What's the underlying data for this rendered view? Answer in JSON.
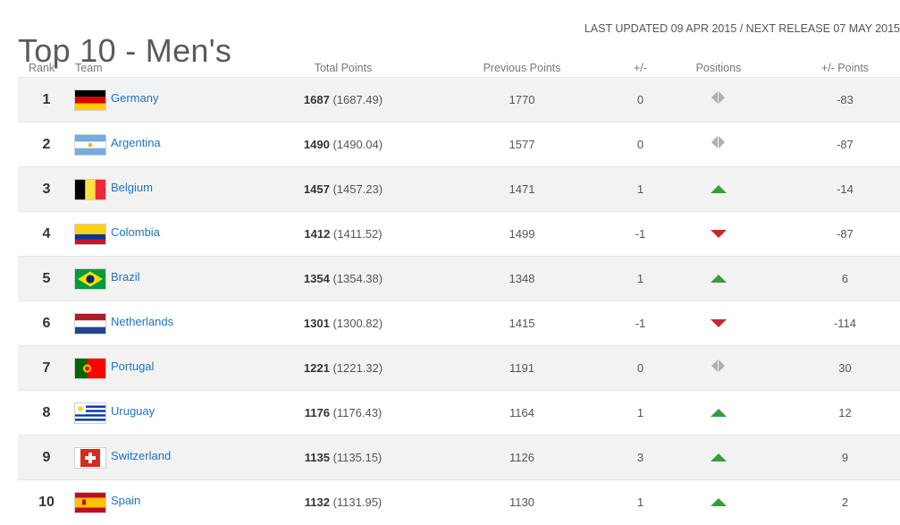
{
  "header": {
    "title": "Top 10 - Men's",
    "updated": "LAST UPDATED 09 APR 2015 / NEXT RELEASE 07 MAY 2015"
  },
  "columns": {
    "rank": "Rank",
    "team": "Team",
    "total": "Total Points",
    "previous": "Previous Points",
    "diff": "+/-",
    "positions": "Positions",
    "points_diff": "+/- Points"
  },
  "colors": {
    "up": "#3a9b3a",
    "down": "#c8282d",
    "same": "#b0b0b0",
    "link": "#1e73be"
  },
  "rows": [
    {
      "rank": "1",
      "team": "Germany",
      "flag": "germany-flag-icon",
      "points": "1687",
      "exact": "(1687.49)",
      "previous": "1770",
      "diff": "0",
      "movement": "same",
      "points_diff": "-83"
    },
    {
      "rank": "2",
      "team": "Argentina",
      "flag": "argentina-flag-icon",
      "points": "1490",
      "exact": "(1490.04)",
      "previous": "1577",
      "diff": "0",
      "movement": "same",
      "points_diff": "-87"
    },
    {
      "rank": "3",
      "team": "Belgium",
      "flag": "belgium-flag-icon",
      "points": "1457",
      "exact": "(1457.23)",
      "previous": "1471",
      "diff": "1",
      "movement": "up",
      "points_diff": "-14"
    },
    {
      "rank": "4",
      "team": "Colombia",
      "flag": "colombia-flag-icon",
      "points": "1412",
      "exact": "(1411.52)",
      "previous": "1499",
      "diff": "-1",
      "movement": "down",
      "points_diff": "-87"
    },
    {
      "rank": "5",
      "team": "Brazil",
      "flag": "brazil-flag-icon",
      "points": "1354",
      "exact": "(1354.38)",
      "previous": "1348",
      "diff": "1",
      "movement": "up",
      "points_diff": "6"
    },
    {
      "rank": "6",
      "team": "Netherlands",
      "flag": "netherlands-flag-icon",
      "points": "1301",
      "exact": "(1300.82)",
      "previous": "1415",
      "diff": "-1",
      "movement": "down",
      "points_diff": "-114"
    },
    {
      "rank": "7",
      "team": "Portugal",
      "flag": "portugal-flag-icon",
      "points": "1221",
      "exact": "(1221.32)",
      "previous": "1191",
      "diff": "0",
      "movement": "same",
      "points_diff": "30"
    },
    {
      "rank": "8",
      "team": "Uruguay",
      "flag": "uruguay-flag-icon",
      "points": "1176",
      "exact": "(1176.43)",
      "previous": "1164",
      "diff": "1",
      "movement": "up",
      "points_diff": "12"
    },
    {
      "rank": "9",
      "team": "Switzerland",
      "flag": "switzerland-flag-icon",
      "points": "1135",
      "exact": "(1135.15)",
      "previous": "1126",
      "diff": "3",
      "movement": "up",
      "points_diff": "9"
    },
    {
      "rank": "10",
      "team": "Spain",
      "flag": "spain-flag-icon",
      "points": "1132",
      "exact": "(1131.95)",
      "previous": "1130",
      "diff": "1",
      "movement": "up",
      "points_diff": "2"
    }
  ]
}
